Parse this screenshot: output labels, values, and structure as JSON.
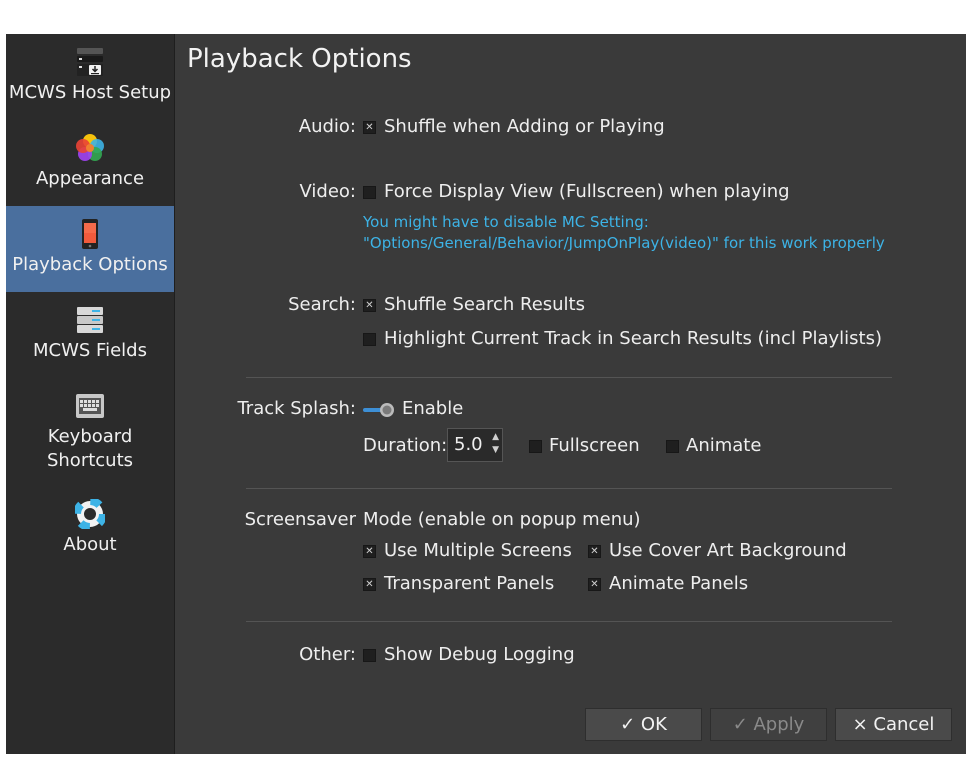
{
  "sidebar": {
    "items": [
      {
        "label": "MCWS Host Setup",
        "icon": "server-download-icon"
      },
      {
        "label": "Appearance",
        "icon": "color-palette-icon"
      },
      {
        "label": "Playback Options",
        "icon": "phone-icon"
      },
      {
        "label": "MCWS Fields",
        "icon": "storage-icon"
      },
      {
        "label": "Keyboard",
        "label2": "Shortcuts",
        "icon": "keyboard-icon"
      },
      {
        "label": "About",
        "icon": "lifebuoy-icon"
      }
    ],
    "active_index": 2,
    "active_color": "#4a6f9e"
  },
  "page": {
    "title": "Playback Options"
  },
  "audio": {
    "label": "Audio:",
    "shuffle_label": "Shuffle when Adding or Playing",
    "shuffle_checked": true
  },
  "video": {
    "label": "Video:",
    "force_display_label": "Force Display View (Fullscreen) when playing",
    "force_display_checked": false,
    "note_line1": "You might have to disable MC Setting:",
    "note_line2": "\"Options/General/Behavior/JumpOnPlay(video)\" for this work properly"
  },
  "search": {
    "label": "Search:",
    "shuffle_label": "Shuffle Search Results",
    "shuffle_checked": true,
    "highlight_label": "Highlight Current Track in Search Results (incl Playlists)",
    "highlight_checked": false
  },
  "track_splash": {
    "label": "Track Splash:",
    "enable_label": "Enable",
    "enabled": true,
    "duration_label": "Duration:",
    "duration_value": "5.0",
    "fullscreen_label": "Fullscreen",
    "fullscreen_checked": false,
    "animate_label": "Animate",
    "animate_checked": false
  },
  "screensaver": {
    "label": "Screensaver",
    "mode_label": "Mode (enable on popup menu)",
    "multiple_screens_label": "Use Multiple Screens",
    "cover_art_label": "Use Cover Art Background",
    "transparent_label": "Transparent Panels",
    "animate_panels_label": "Animate Panels"
  },
  "other": {
    "label": "Other:",
    "debug_label": "Show Debug Logging",
    "debug_checked": false
  },
  "buttons": {
    "ok": "✓ OK",
    "apply": "✓ Apply",
    "cancel": "× Cancel"
  },
  "colors": {
    "note": "#3db3e6",
    "background": "#3a3a3a",
    "sidebar": "#2b2b2b"
  }
}
